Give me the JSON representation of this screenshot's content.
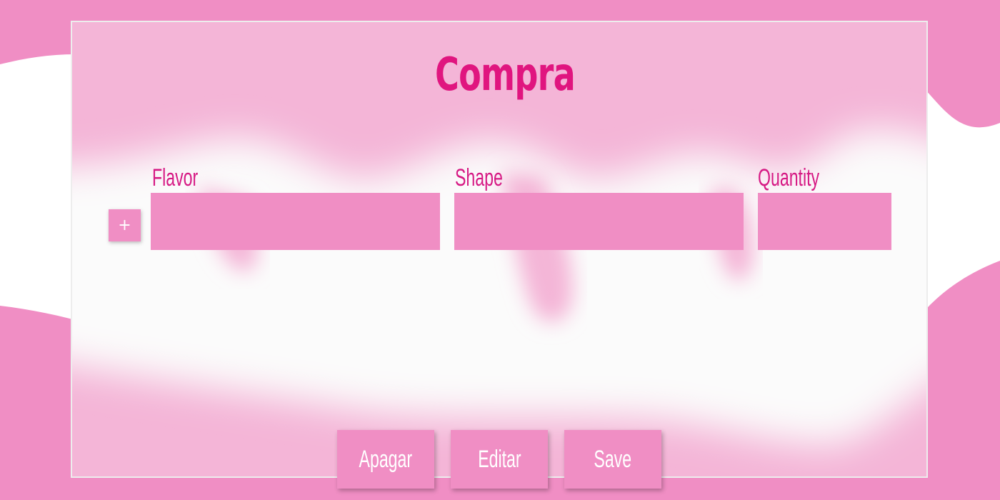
{
  "page": {
    "title": "Compra"
  },
  "theme": {
    "background": "#f08ec4",
    "panel": "#f4b5d7",
    "accent": "#e0157f",
    "button": "#f08ec4",
    "button_text": "#ffffff"
  },
  "form": {
    "add_icon": "plus-icon",
    "add_label": "+",
    "fields": [
      {
        "label": "Flavor",
        "value": ""
      },
      {
        "label": "Shape",
        "value": ""
      },
      {
        "label": "Quantity",
        "value": ""
      }
    ]
  },
  "actions": {
    "delete_label": "Apagar",
    "edit_label": "Editar",
    "save_label": "Save"
  }
}
